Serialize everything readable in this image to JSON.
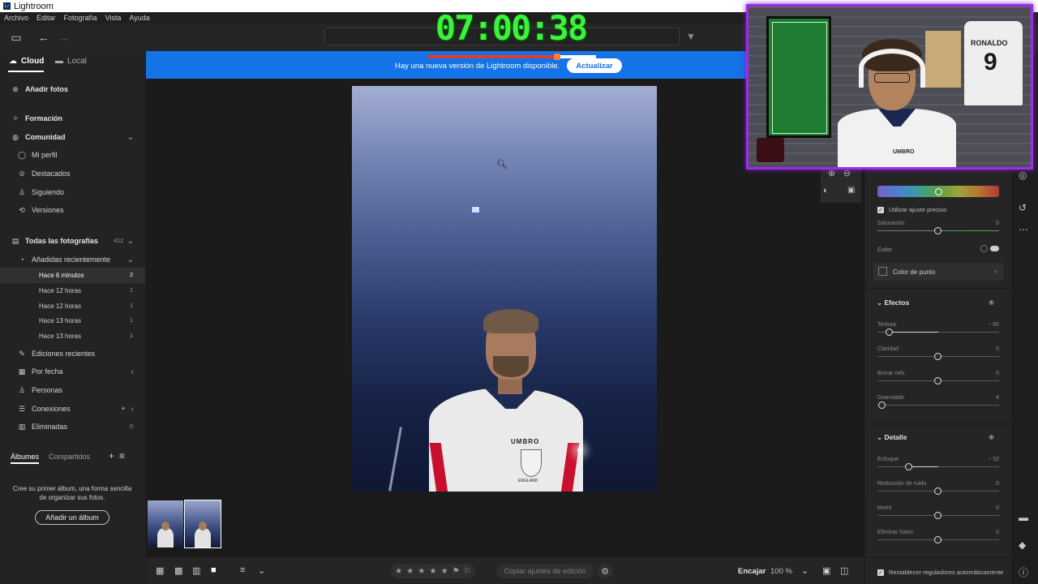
{
  "app": {
    "title": "Lightroom",
    "logo_text": "Lr"
  },
  "menu": [
    "Archivo",
    "Editar",
    "Fotografía",
    "Vista",
    "Ayuda"
  ],
  "timer": {
    "text": "07:00:38",
    "progress": 0.77
  },
  "sources": {
    "cloud": "Cloud",
    "local": "Local"
  },
  "left": {
    "add_photos": "Añadir fotos",
    "learn": "Formación",
    "community": "Comunidad",
    "my_profile": "Mi perfil",
    "featured": "Destacados",
    "following": "Siguiendo",
    "versions": "Versiones",
    "all_photos": "Todas las fotografías",
    "all_photos_count": "412",
    "recently_added": "Añadidas recientemente",
    "recent_items": [
      {
        "label": "Hace 6 minutos",
        "count": "2"
      },
      {
        "label": "Hace 12 horas",
        "count": "1"
      },
      {
        "label": "Hace 12 horas",
        "count": "1"
      },
      {
        "label": "Hace 13 horas",
        "count": "1"
      },
      {
        "label": "Hace 13 horas",
        "count": "1"
      }
    ],
    "recent_edits": "Ediciones recientes",
    "by_date": "Por fecha",
    "people": "Personas",
    "connections": "Conexiones",
    "deleted": "Eliminadas",
    "deleted_count": "0",
    "albums_tab": "Álbumes",
    "shared_tab": "Compartidos",
    "album_hint": "Cree su primer álbum, una forma sencilla de organizar sus fotos.",
    "add_album": "Añadir un álbum"
  },
  "banner": {
    "text": "Hay una nueva versión de Lightroom disponible.",
    "button": "Actualizar",
    "color": "#1473e6"
  },
  "photo": {
    "shirt_brand": "UMBRO",
    "crest_text": "ENGLAND"
  },
  "bottombar": {
    "copy_label": "Copiar ajustes de edición",
    "fit": "Encajar",
    "zoom": "100 %"
  },
  "edit": {
    "precise": "Utilizar ajuste preciso",
    "saturation": {
      "label": "Saturación",
      "value": "0",
      "pos": 0.5
    },
    "color": "Color",
    "point_color": "Color de punto",
    "effects": {
      "title": "Efectos",
      "sliders": [
        {
          "label": "Textura",
          "value": "− 80",
          "pos": 0.1
        },
        {
          "label": "Claridad",
          "value": "0",
          "pos": 0.5
        },
        {
          "label": "Borrar neb.",
          "value": "0",
          "pos": 0.5
        },
        {
          "label": "Granulado",
          "value": "4",
          "pos": 0.04
        }
      ]
    },
    "detail": {
      "title": "Detalle",
      "sliders": [
        {
          "label": "Enfoque",
          "value": "− 52",
          "pos": 0.26
        },
        {
          "label": "Reducción de ruido",
          "value": "0",
          "pos": 0.5
        },
        {
          "label": "Moiré",
          "value": "0",
          "pos": 0.5
        },
        {
          "label": "Eliminar halos",
          "value": "0",
          "pos": 0.5
        }
      ]
    },
    "auto_reset": "Restablecer reguladores automáticamente"
  },
  "webcam": {
    "jersey_name": "RONALDO",
    "jersey_number": "9",
    "shirt_brand": "UMBRO"
  }
}
